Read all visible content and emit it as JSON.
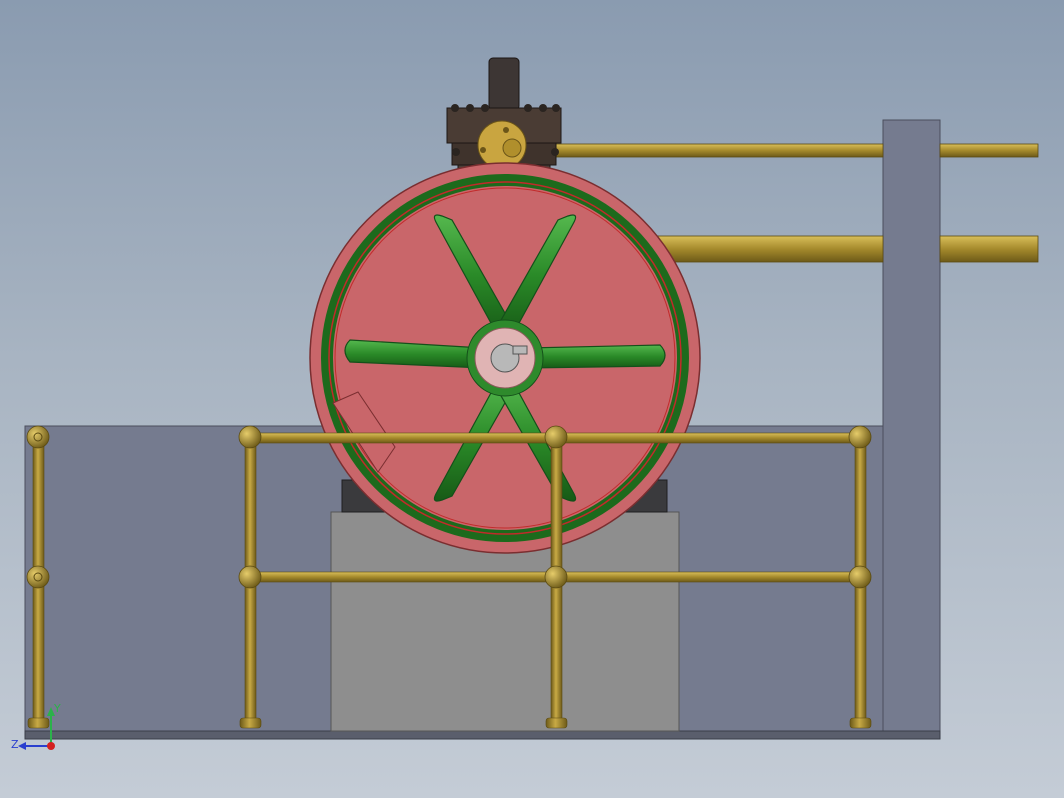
{
  "viewport": {
    "background_top": "#8a9bb0",
    "background_bottom": "#c4ccd6"
  },
  "colors": {
    "panel": "#757b8f",
    "panel_edge": "#4a4e5c",
    "plinth": "#8e8e8e",
    "brass": "#a08428",
    "brass_light": "#d2b44a",
    "flywheel_rim": "#c9666a",
    "flywheel_spokes": "#2e8a2c",
    "cast_iron": "#3a3a3d",
    "cylinder_dark": "#4a3c34",
    "hub": "#e0b4b4"
  },
  "triad": {
    "x_label": "",
    "y_label": "Y",
    "z_label": "Z"
  },
  "icons": [
    "axis-triad-icon"
  ]
}
